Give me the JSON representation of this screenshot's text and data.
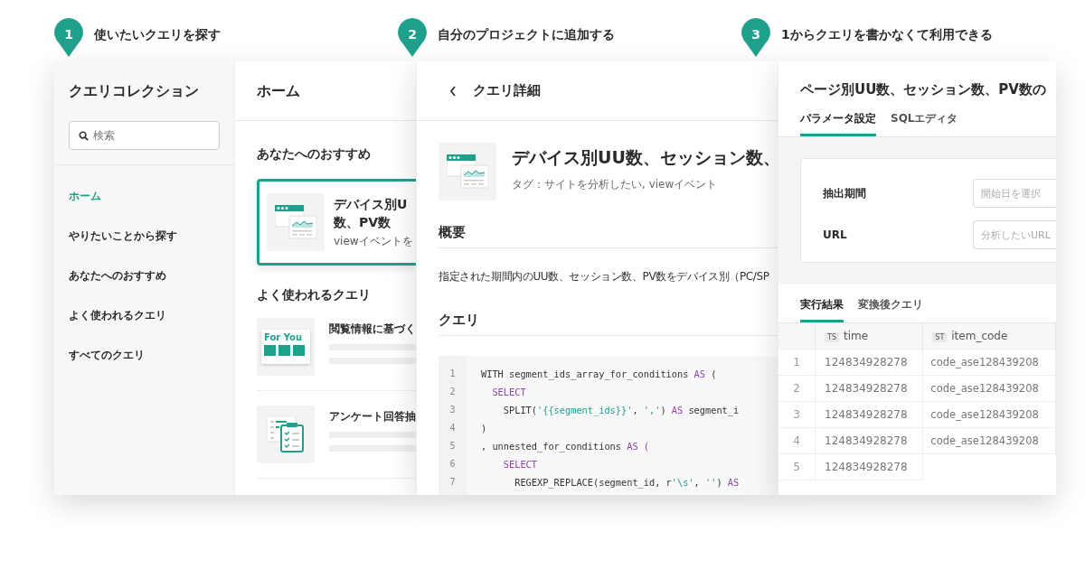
{
  "steps": [
    {
      "number": "1",
      "label": "使いたいクエリを探す"
    },
    {
      "number": "2",
      "label": "自分のプロジェクトに追加する"
    },
    {
      "number": "3",
      "label": "1からクエリを書かなくて利用できる"
    }
  ],
  "collection": {
    "title": "クエリコレクション",
    "search": {
      "placeholder": "検索"
    },
    "nav": [
      {
        "label": "ホーム",
        "selected": true
      },
      {
        "label": "やりたいことから探す",
        "selected": false
      },
      {
        "label": "あなたへのおすすめ",
        "selected": false
      },
      {
        "label": "よく使われるクエリ",
        "selected": false
      },
      {
        "label": "すべてのクエリ",
        "selected": false
      }
    ],
    "home": {
      "title": "ホーム",
      "recommend_heading": "あなたへのおすすめ",
      "recommend_card": {
        "title_lines": [
          "デバイス別U",
          "数、PV数"
        ],
        "subtitle": "viewイベントを"
      },
      "popular_heading": "よく使われるクエリ",
      "popular": [
        {
          "kind": "for-you",
          "thumb_label": "For You",
          "title": "閲覧情報に基づく"
        },
        {
          "kind": "clipboard",
          "title": "アンケート回答抽"
        }
      ]
    }
  },
  "detail": {
    "title": "クエリ詳細",
    "query_title": "デバイス別UU数、セッション数、",
    "tags": "タグ：サイトを分析したい, viewイベント",
    "overview_heading": "概要",
    "description": "指定された期間内のUU数、セッション数、PV数をデバイス別（PC/SP",
    "query_heading": "クエリ",
    "code": [
      {
        "number": "1",
        "segments": [
          {
            "kind": "plain",
            "text": "WITH segment_ids_array_for_conditions "
          },
          {
            "kind": "keyword",
            "text": "AS"
          },
          {
            "kind": "plain",
            "text": " ("
          }
        ]
      },
      {
        "number": "2",
        "segments": [
          {
            "kind": "keyword",
            "text": "  SELECT"
          }
        ]
      },
      {
        "number": "3",
        "segments": [
          {
            "kind": "plain",
            "text": "    SPLIT("
          },
          {
            "kind": "string",
            "text": "'{{segment_ids}}'"
          },
          {
            "kind": "plain",
            "text": ", "
          },
          {
            "kind": "string",
            "text": "','"
          },
          {
            "kind": "plain",
            "text": ") "
          },
          {
            "kind": "keyword",
            "text": "AS"
          },
          {
            "kind": "plain",
            "text": " segment_i"
          }
        ]
      },
      {
        "number": "4",
        "segments": [
          {
            "kind": "plain",
            "text": ")"
          }
        ]
      },
      {
        "number": "5",
        "segments": [
          {
            "kind": "plain",
            "text": ", unnested_for_conditions "
          },
          {
            "kind": "keyword",
            "text": "AS ("
          }
        ]
      },
      {
        "number": "6",
        "segments": [
          {
            "kind": "keyword",
            "text": "    SELECT"
          }
        ]
      },
      {
        "number": "7",
        "segments": [
          {
            "kind": "plain",
            "text": "      REGEXP_REPLACE(segment_id, r"
          },
          {
            "kind": "string",
            "text": "'\\s'"
          },
          {
            "kind": "plain",
            "text": ", "
          },
          {
            "kind": "string",
            "text": "''"
          },
          {
            "kind": "plain",
            "text": ") "
          },
          {
            "kind": "keyword",
            "text": "AS"
          }
        ]
      }
    ]
  },
  "result": {
    "title": "ページ別UU数、セッション数、PV数の",
    "tabs": [
      {
        "label": "パラメータ設定",
        "selected": true
      },
      {
        "label": "SQLエディタ",
        "selected": false
      }
    ],
    "params": [
      {
        "label": "抽出期間",
        "placeholder": "開始日を選択"
      },
      {
        "label": "URL",
        "placeholder": "分析したいURL"
      }
    ],
    "result_tabs": [
      {
        "label": "実行結果",
        "selected": true
      },
      {
        "label": "変換後クエリ",
        "selected": false
      }
    ],
    "table": {
      "columns": [
        {
          "type": "TS",
          "name": "time"
        },
        {
          "type": "ST",
          "name": "item_code"
        }
      ],
      "rows": [
        {
          "number": "1",
          "cells": [
            "124834928278",
            "code_ase128439208"
          ]
        },
        {
          "number": "2",
          "cells": [
            "124834928278",
            "code_ase128439208"
          ]
        },
        {
          "number": "3",
          "cells": [
            "124834928278",
            "code_ase128439208"
          ]
        },
        {
          "number": "4",
          "cells": [
            "124834928278",
            "code_ase128439208"
          ]
        },
        {
          "number": "5",
          "cells": [
            "124834928278"
          ]
        }
      ]
    }
  }
}
